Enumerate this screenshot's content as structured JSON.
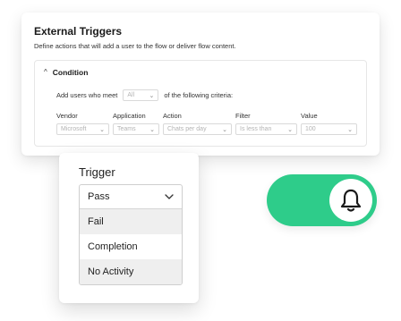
{
  "colors": {
    "toggle_on": "#2ecc8a",
    "bell": "#1a1a1a"
  },
  "external_triggers": {
    "title": "External Triggers",
    "subtitle": "Define actions that will add a user to the flow or deliver flow content.",
    "condition": {
      "label": "Condition",
      "criteria_prefix": "Add users who meet",
      "criteria_select": "All",
      "criteria_suffix": "of the following criteria:",
      "columns": [
        {
          "label": "Vendor",
          "value": "Microsoft"
        },
        {
          "label": "Application",
          "value": "Teams"
        },
        {
          "label": "Action",
          "value": "Chats per day"
        },
        {
          "label": "Filter",
          "value": "Is less than"
        },
        {
          "label": "Value",
          "value": "100"
        }
      ]
    }
  },
  "trigger": {
    "title": "Trigger",
    "selected": "Pass",
    "options": [
      "Fail",
      "Completion",
      "No Activity"
    ]
  },
  "toggle": {
    "state": "on",
    "icon": "bell-icon"
  }
}
